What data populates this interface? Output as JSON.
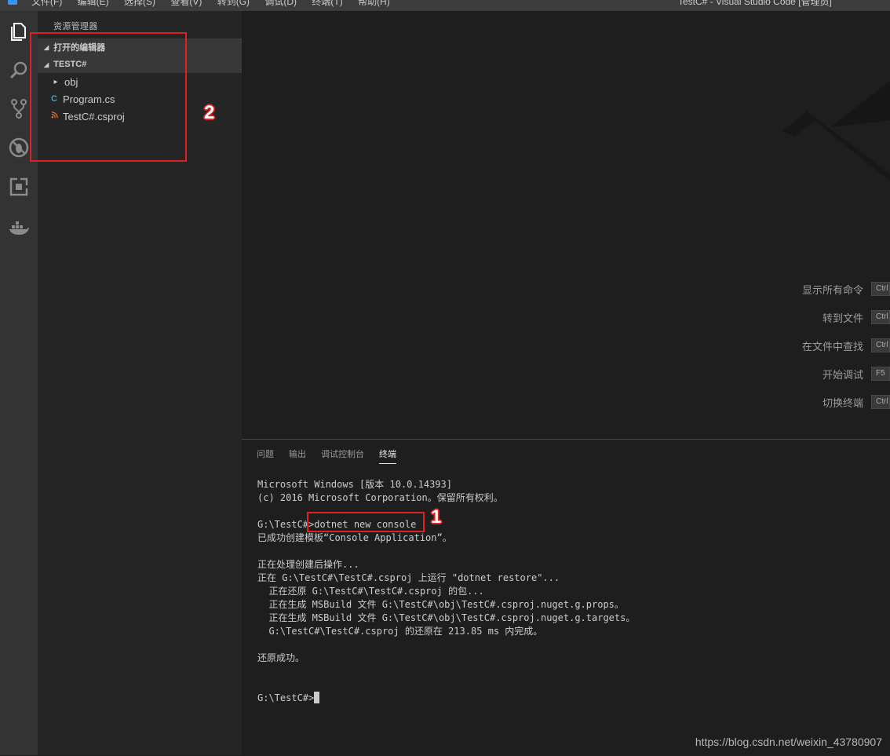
{
  "titlebar": {
    "menu": [
      "文件(F)",
      "编辑(E)",
      "选择(S)",
      "查看(V)",
      "转到(G)",
      "调试(D)",
      "终端(T)",
      "帮助(H)"
    ],
    "window_title": "TestC# - Visual Studio Code [管理员]"
  },
  "activitybar": {
    "items": [
      "explorer-icon",
      "search-icon",
      "source-control-icon",
      "debug-icon",
      "extensions-icon",
      "docker-icon"
    ]
  },
  "sidebar": {
    "title": "资源管理器",
    "open_editors": "打开的编辑器",
    "project": "TESTC#",
    "items": [
      {
        "label": "obj",
        "icon": "folder-chevron-icon"
      },
      {
        "label": "Program.cs",
        "icon": "csharp-file-icon"
      },
      {
        "label": "TestC#.csproj",
        "icon": "rss-file-icon"
      }
    ]
  },
  "editor": {
    "shortcuts": [
      {
        "label": "显示所有命令",
        "key": "Ctrl"
      },
      {
        "label": "转到文件",
        "key": "Ctrl"
      },
      {
        "label": "在文件中查找",
        "key": "Ctrl"
      },
      {
        "label": "开始调试",
        "key": "F5"
      },
      {
        "label": "切换终端",
        "key": "Ctrl"
      }
    ]
  },
  "panel": {
    "tabs": [
      "问题",
      "输出",
      "调试控制台",
      "终端"
    ],
    "active_tab": "终端",
    "terminal_lines": [
      "Microsoft Windows [版本 10.0.14393]",
      "(c) 2016 Microsoft Corporation。保留所有权利。",
      "",
      "G:\\TestC#>dotnet new console",
      "已成功创建模板“Console Application”。",
      "",
      "正在处理创建后操作...",
      "正在 G:\\TestC#\\TestC#.csproj 上运行 \"dotnet restore\"...",
      "  正在还原 G:\\TestC#\\TestC#.csproj 的包...",
      "  正在生成 MSBuild 文件 G:\\TestC#\\obj\\TestC#.csproj.nuget.g.props。",
      "  正在生成 MSBuild 文件 G:\\TestC#\\obj\\TestC#.csproj.nuget.g.targets。",
      "  G:\\TestC#\\TestC#.csproj 的还原在 213.85 ms 内完成。",
      "",
      "还原成功。",
      "",
      ""
    ],
    "prompt": "G:\\TestC#>"
  },
  "annotations": {
    "box1": "1",
    "box2": "2"
  },
  "watermark": "https://blog.csdn.net/weixin_43780907",
  "colors": {
    "accent": "#3794ff",
    "annotation": "#e02020"
  }
}
